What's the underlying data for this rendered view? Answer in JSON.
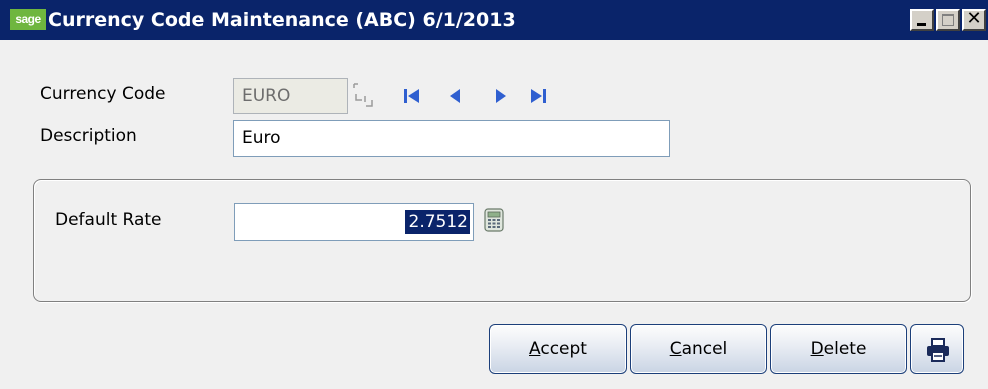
{
  "window": {
    "logo_text": "sage",
    "title": "Currency Code Maintenance (ABC) 6/1/2013",
    "close_glyph": "✕"
  },
  "form": {
    "currency_code_label": "Currency Code",
    "currency_code_value": "EURO",
    "description_label": "Description",
    "description_value": "Euro"
  },
  "rates": {
    "default_rate_label": "Default Rate",
    "default_rate_value": "2.7512"
  },
  "buttons": {
    "accept": {
      "accel": "A",
      "rest": "ccept"
    },
    "cancel": {
      "accel": "C",
      "rest": "ancel"
    },
    "delete": {
      "accel": "D",
      "rest": "elete"
    }
  },
  "icons": {
    "lookup": "lookup-icon",
    "nav_first": "first-record-icon",
    "nav_prev": "previous-record-icon",
    "nav_next": "next-record-icon",
    "nav_last": "last-record-icon",
    "calculator": "calculator-icon",
    "print": "printer-icon"
  },
  "colors": {
    "titlebar": "#0a246a",
    "nav_arrows": "#2f5fd0",
    "selection": "#0a246a"
  }
}
